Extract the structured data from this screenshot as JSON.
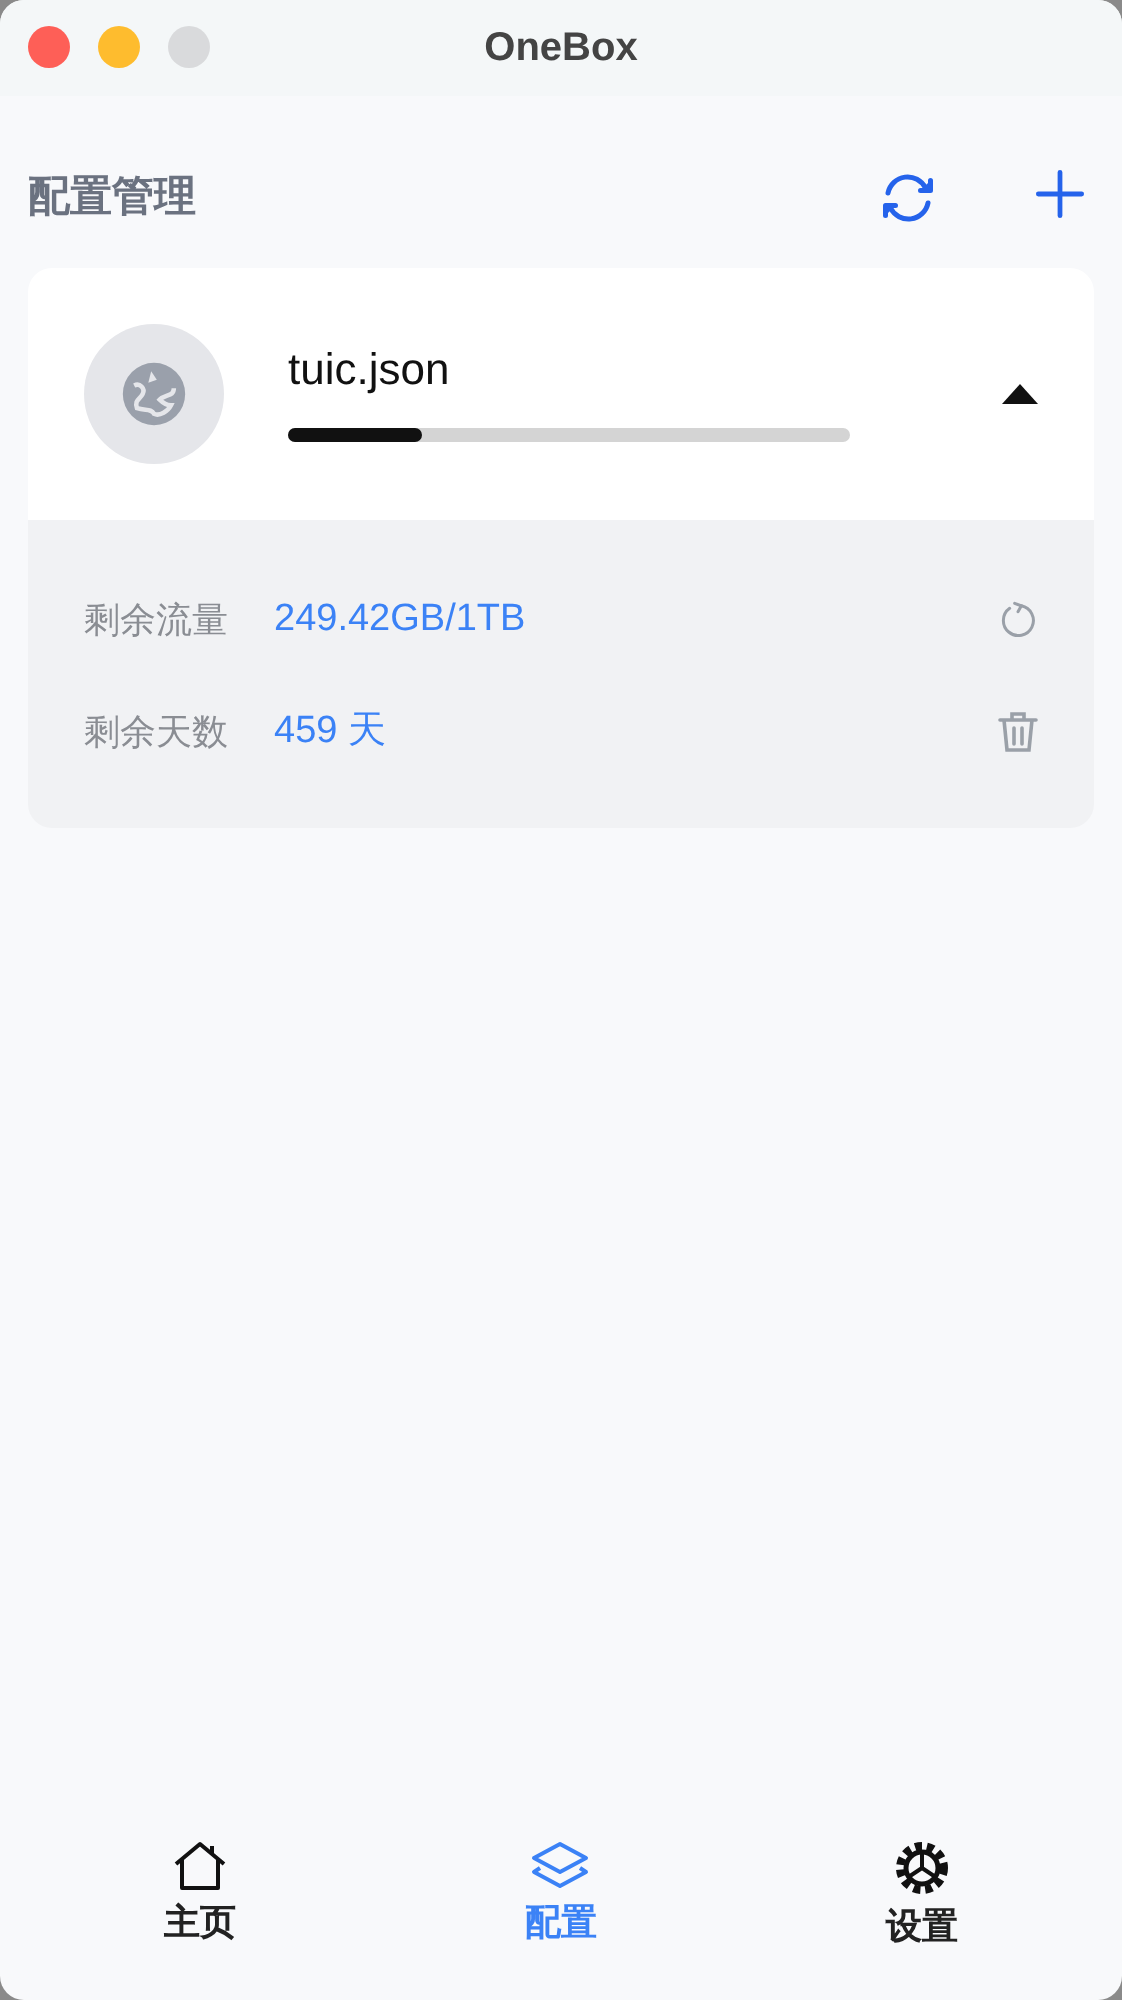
{
  "window": {
    "title": "OneBox"
  },
  "header": {
    "title": "配置管理"
  },
  "profiles": [
    {
      "name": "tuic.json",
      "level": 0.24,
      "expanded": true,
      "details": [
        {
          "label": "剩余流量",
          "value": "249.42GB/1TB",
          "kind": "refresh"
        },
        {
          "label": "剩余天数",
          "value": "459 天",
          "kind": "delete"
        }
      ]
    }
  ],
  "tabs": [
    {
      "label": "主页",
      "kind": "home",
      "selected": false
    },
    {
      "label": "配置",
      "kind": "layers",
      "selected": true
    },
    {
      "label": "设置",
      "kind": "gear",
      "selected": false
    }
  ]
}
